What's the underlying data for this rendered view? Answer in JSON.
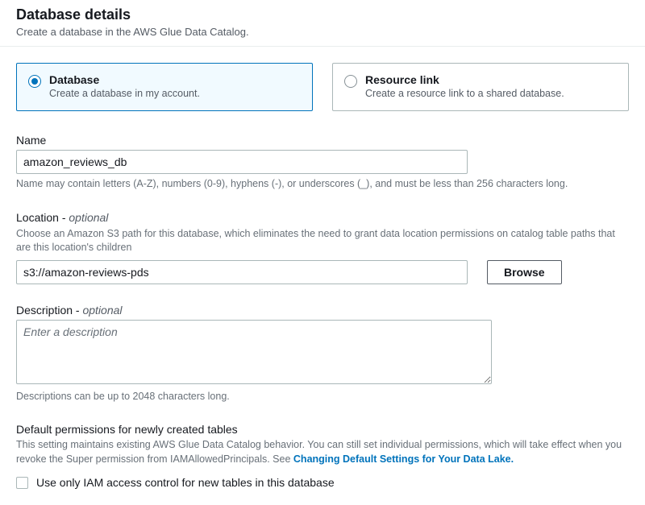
{
  "header": {
    "title": "Database details",
    "subtitle": "Create a database in the AWS Glue Data Catalog."
  },
  "type_options": {
    "database": {
      "title": "Database",
      "desc": "Create a database in my account."
    },
    "resource_link": {
      "title": "Resource link",
      "desc": "Create a resource link to a shared database."
    }
  },
  "name_field": {
    "label": "Name",
    "value": "amazon_reviews_db",
    "hint": "Name may contain letters (A-Z), numbers (0-9), hyphens (-), or underscores (_), and must be less than 256 characters long."
  },
  "location_field": {
    "label": "Location - ",
    "optional": "optional",
    "hint_above": "Choose an Amazon S3 path for this database, which eliminates the need to grant data location permissions on catalog table paths that are this location's children",
    "value": "s3://amazon-reviews-pds",
    "browse": "Browse"
  },
  "description_field": {
    "label": "Description - ",
    "optional": "optional",
    "placeholder": "Enter a description",
    "value": "",
    "hint": "Descriptions can be up to 2048 characters long."
  },
  "permissions_section": {
    "title": "Default permissions for newly created tables",
    "hint_prefix": "This setting maintains existing AWS Glue Data Catalog behavior. You can still set individual permissions, which will take effect when you revoke the Super permission from IAMAllowedPrincipals. See ",
    "link_text": "Changing Default Settings for Your Data Lake.",
    "checkbox_label": "Use only IAM access control for new tables in this database"
  }
}
